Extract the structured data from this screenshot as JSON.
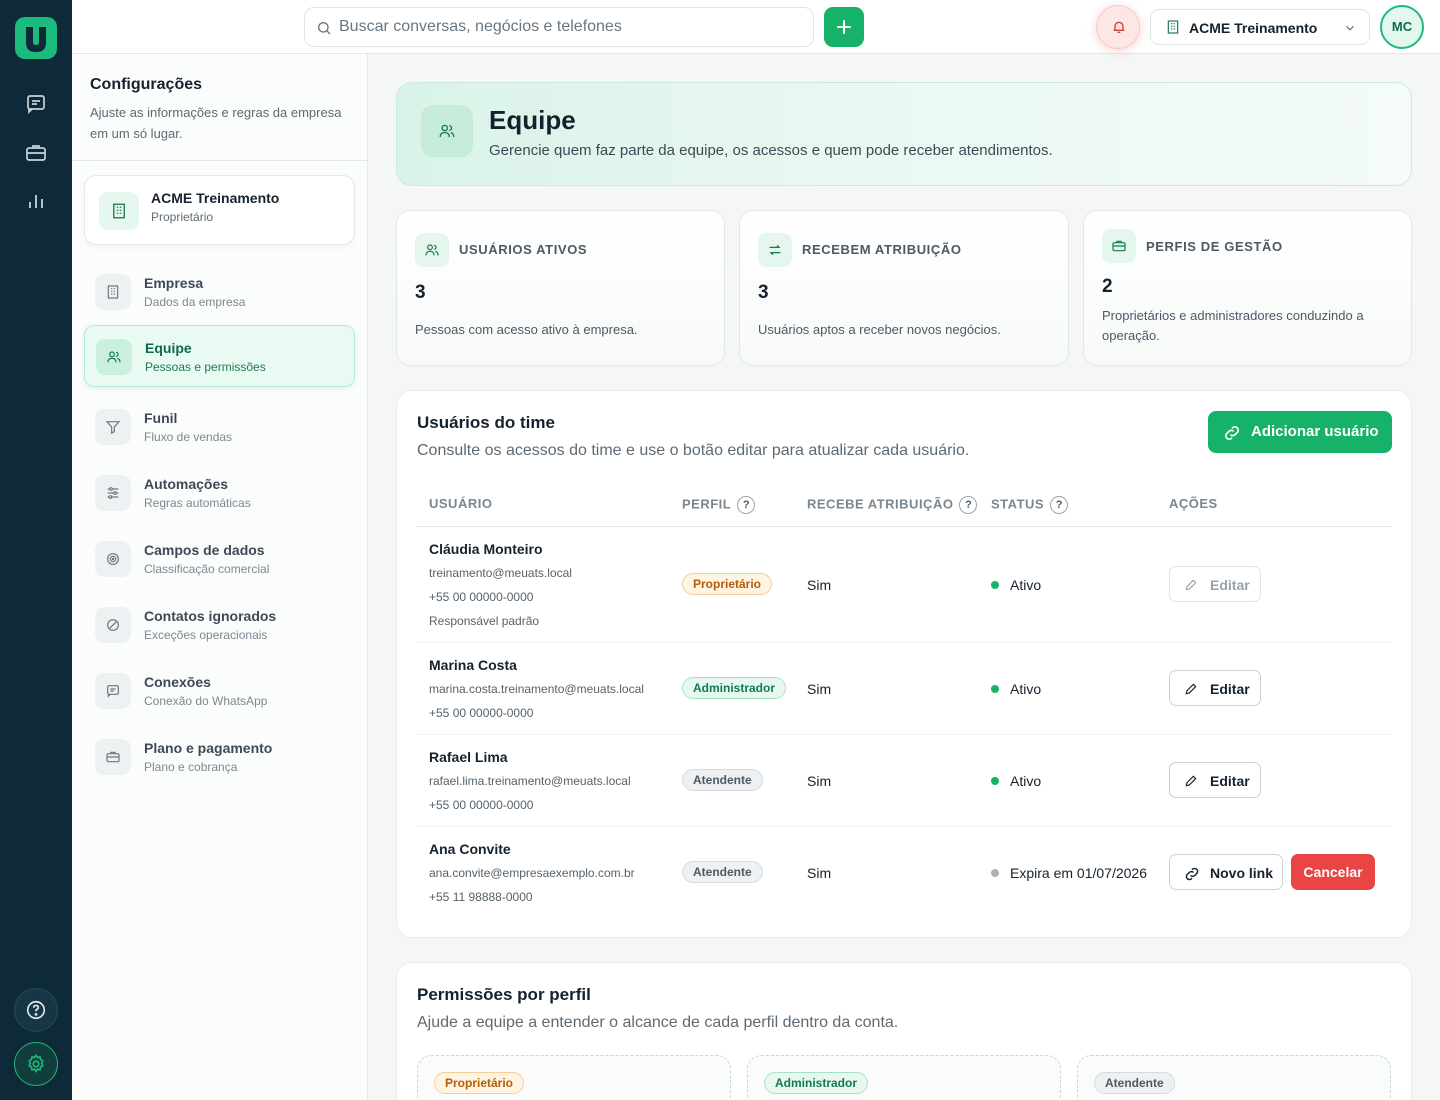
{
  "topbar": {
    "search_placeholder": "Buscar conversas, negócios e telefones",
    "company": "ACME Treinamento",
    "avatar_initials": "MC"
  },
  "sidebar": {
    "title": "Configurações",
    "description": "Ajuste as informações e regras da empresa em um só lugar.",
    "org": {
      "name": "ACME Treinamento",
      "role": "Proprietário"
    },
    "items": [
      {
        "label": "Empresa",
        "sub": "Dados da empresa",
        "icon": "building-icon"
      },
      {
        "label": "Equipe",
        "sub": "Pessoas e permissões",
        "icon": "users-icon",
        "active": true
      },
      {
        "label": "Funil",
        "sub": "Fluxo de vendas",
        "icon": "funnel-icon"
      },
      {
        "label": "Automações",
        "sub": "Regras automáticas",
        "icon": "sliders-icon"
      },
      {
        "label": "Campos de dados",
        "sub": "Classificação comercial",
        "icon": "target-icon"
      },
      {
        "label": "Contatos ignorados",
        "sub": "Exceções operacionais",
        "icon": "block-icon"
      },
      {
        "label": "Conexões",
        "sub": "Conexão do WhatsApp",
        "icon": "chat-icon"
      },
      {
        "label": "Plano e pagamento",
        "sub": "Plano e cobrança",
        "icon": "briefcase-icon"
      }
    ]
  },
  "hero": {
    "title": "Equipe",
    "subtitle": "Gerencie quem faz parte da equipe, os acessos e quem pode receber atendimentos."
  },
  "stats": [
    {
      "label": "USUÁRIOS ATIVOS",
      "value": "3",
      "desc": "Pessoas com acesso ativo à empresa."
    },
    {
      "label": "RECEBEM ATRIBUIÇÃO",
      "value": "3",
      "desc": "Usuários aptos a receber novos negócios."
    },
    {
      "label": "PERFIS DE GESTÃO",
      "value": "2",
      "desc": "Proprietários e administradores conduzindo a operação."
    }
  ],
  "team": {
    "title": "Usuários do time",
    "subtitle": "Consulte os acessos do time e use o botão editar para atualizar cada usuário.",
    "add_label": "Adicionar usuário",
    "columns": [
      "USUÁRIO",
      "PERFIL",
      "RECEBE ATRIBUIÇÃO",
      "STATUS",
      "AÇÕES"
    ],
    "help_glyph": "?",
    "users": [
      {
        "name": "Cláudia Monteiro",
        "email": "treinamento@meuats.local",
        "phone": "+55 00 00000-0000",
        "note": "Responsável padrão",
        "role": "Proprietário",
        "assign": "Sim",
        "status": "Ativo",
        "action": "Editar"
      },
      {
        "name": "Marina Costa",
        "email": "marina.costa.treinamento@meuats.local",
        "phone": "+55 00 00000-0000",
        "role": "Administrador",
        "assign": "Sim",
        "status": "Ativo",
        "action": "Editar"
      },
      {
        "name": "Rafael Lima",
        "email": "rafael.lima.treinamento@meuats.local",
        "phone": "+55 00 00000-0000",
        "role": "Atendente",
        "assign": "Sim",
        "status": "Ativo",
        "action": "Editar"
      },
      {
        "name": "Ana Convite",
        "email": "ana.convite@empresaexemplo.com.br",
        "phone": "+55 11 98888-0000",
        "role": "Atendente",
        "assign": "Sim",
        "status": "Expira em 01/07/2026",
        "action": "Novo link",
        "action2": "Cancelar"
      }
    ]
  },
  "permissions": {
    "title": "Permissões por perfil",
    "subtitle": "Ajude a equipe a entender o alcance de cada perfil dentro da conta.",
    "profiles": [
      "Proprietário",
      "Administrador",
      "Atendente"
    ]
  },
  "colors": {
    "accent": "#17b26a",
    "rail": "#0e2a38",
    "danger": "#e94545"
  }
}
